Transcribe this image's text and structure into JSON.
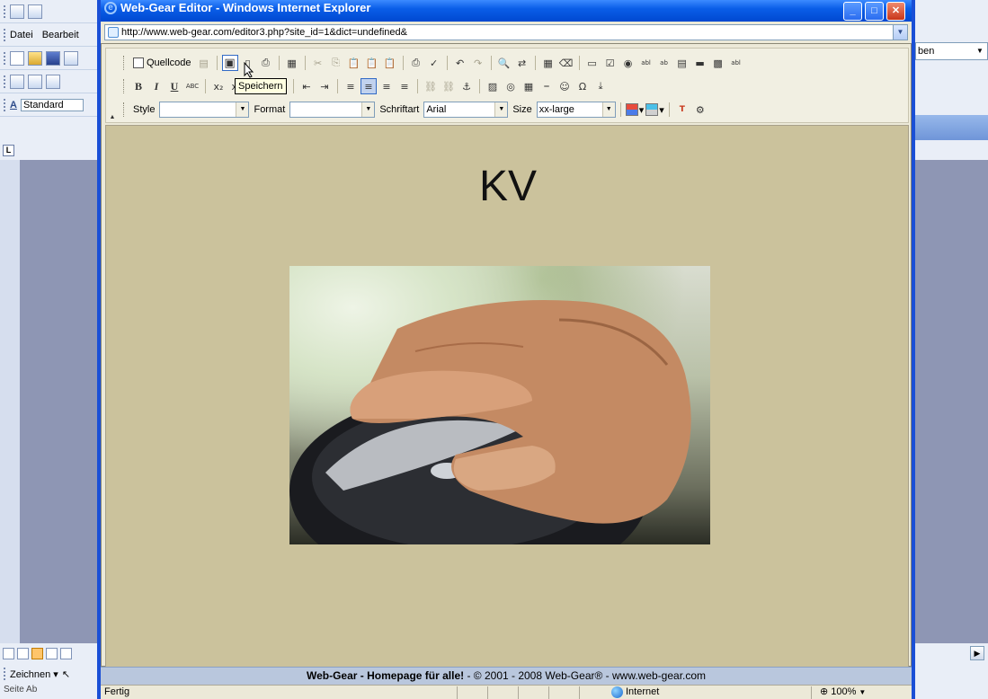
{
  "word": {
    "menu": {
      "datei": "Datei",
      "bearbeiten": "Bearbeit"
    },
    "style_box": "Standard",
    "right_combo": "ben",
    "draw_button": "Zeichnen ▾",
    "status_partial": "Seite  Ab"
  },
  "ie": {
    "title": "Web-Gear Editor - Windows Internet Explorer",
    "url": "http://www.web-gear.com/editor3.php?site_id=1&dict=undefined&",
    "status": "Fertig",
    "zone": "Internet",
    "zoom": "100%"
  },
  "editor": {
    "source_button": "Quellcode",
    "tooltip": "Speichern",
    "labels": {
      "style": "Style",
      "format": "Format",
      "font": "Schriftart",
      "size": "Size"
    },
    "values": {
      "style": "",
      "format": "",
      "font": "Arial",
      "size": "xx-large"
    },
    "heading": "KV",
    "image_alt": "Hand on computer mouse",
    "footer": {
      "bold": "Web-Gear - Homepage für alle!",
      "rest": " - © 2001 - 2008 Web-Gear® - www.web-gear.com"
    }
  },
  "colors": {
    "canvas": "#cbc29c",
    "titlebar": "#0a5ee8",
    "footer": "#b9c7dd"
  }
}
